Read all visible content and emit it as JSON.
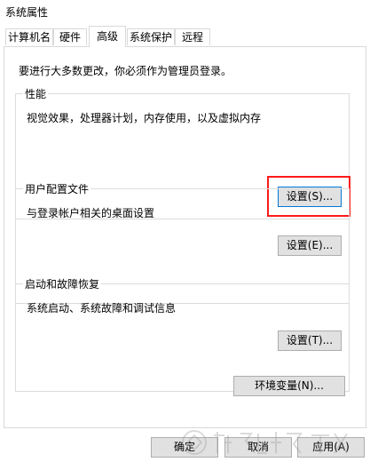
{
  "window": {
    "title": "系统属性"
  },
  "tabs": [
    {
      "label": "计算机名",
      "active": false
    },
    {
      "label": "硬件",
      "active": false
    },
    {
      "label": "高级",
      "active": true
    },
    {
      "label": "系统保护",
      "active": false
    },
    {
      "label": "远程",
      "active": false
    }
  ],
  "notice": "要进行大多数更改，你必须作为管理员登录。",
  "performance": {
    "legend": "性能",
    "description": "视觉效果，处理器计划，内存使用，以及虚拟内存",
    "button_label": "设置(S)..."
  },
  "user_profiles": {
    "legend": "用户配置文件",
    "description": "与登录帐户相关的桌面设置",
    "button_label": "设置(E)..."
  },
  "startup_recovery": {
    "legend": "启动和故障恢复",
    "description": "系统启动、系统故障和调试信息",
    "button_label": "设置(T)..."
  },
  "env_vars_button": "环境变量(N)...",
  "footer": {
    "ok_label": "确定",
    "cancel_label": "取消",
    "apply_label": "应用(A)"
  },
  "colors": {
    "highlight": "#ff1a1a",
    "focus_border": "#0078d7"
  }
}
